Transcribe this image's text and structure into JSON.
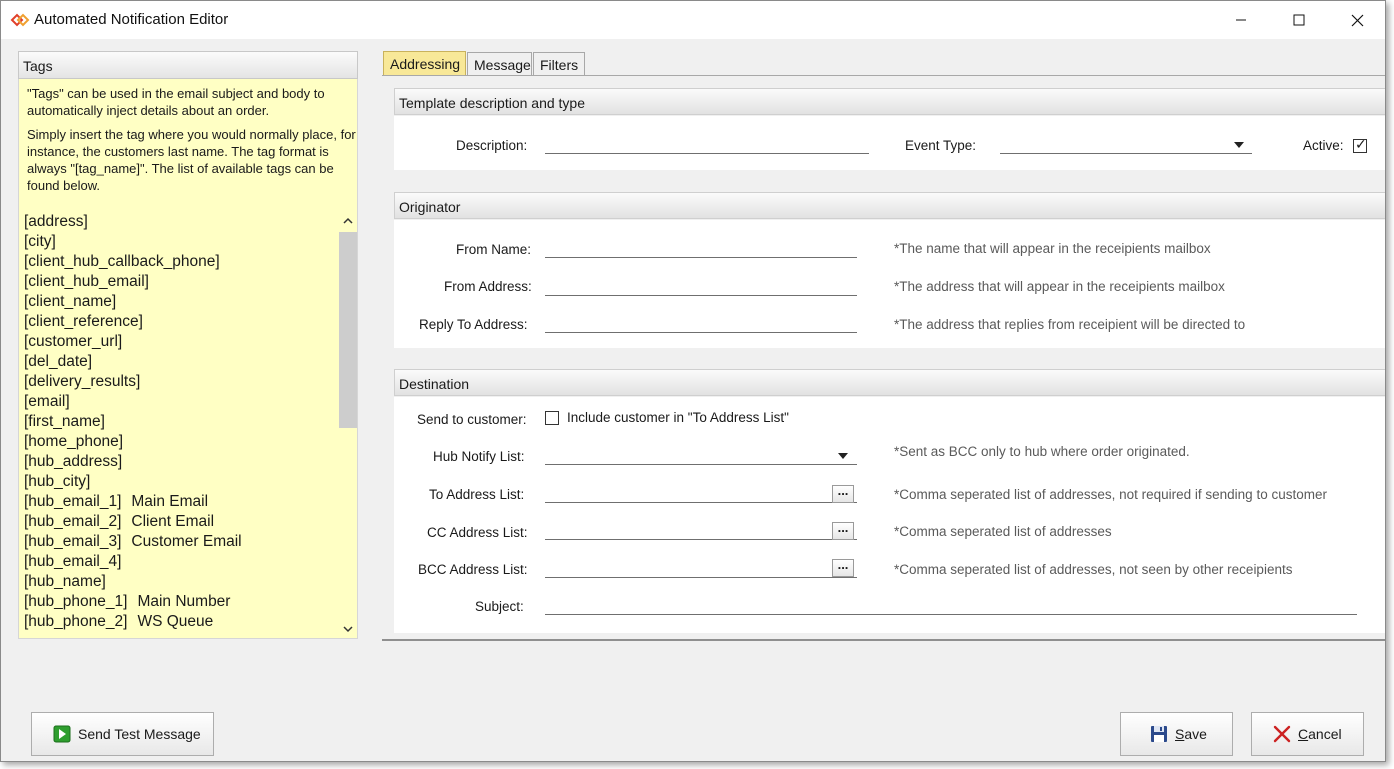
{
  "window": {
    "title": "Automated Notification Editor"
  },
  "tags_panel": {
    "header": "Tags",
    "intro": "\"Tags\" can be used in the email subject and body to automatically inject details about an order.",
    "instructions": "Simply insert the tag where you would normally place, for instance, the customers last name.  The tag format is always \"[tag_name]\".  The list of available tags can be found below.",
    "tags": [
      {
        "name": "[address]",
        "desc": ""
      },
      {
        "name": "[city]",
        "desc": ""
      },
      {
        "name": "[client_hub_callback_phone]",
        "desc": ""
      },
      {
        "name": "[client_hub_email]",
        "desc": ""
      },
      {
        "name": "[client_name]",
        "desc": ""
      },
      {
        "name": "[client_reference]",
        "desc": ""
      },
      {
        "name": "[customer_url]",
        "desc": ""
      },
      {
        "name": "[del_date]",
        "desc": ""
      },
      {
        "name": "[delivery_results]",
        "desc": ""
      },
      {
        "name": "[email]",
        "desc": ""
      },
      {
        "name": "[first_name]",
        "desc": ""
      },
      {
        "name": "[home_phone]",
        "desc": ""
      },
      {
        "name": "[hub_address]",
        "desc": ""
      },
      {
        "name": "[hub_city]",
        "desc": ""
      },
      {
        "name": "[hub_email_1]",
        "desc": "Main Email"
      },
      {
        "name": "[hub_email_2]",
        "desc": "Client Email"
      },
      {
        "name": "[hub_email_3]",
        "desc": "Customer Email"
      },
      {
        "name": "[hub_email_4]",
        "desc": ""
      },
      {
        "name": "[hub_name]",
        "desc": ""
      },
      {
        "name": "[hub_phone_1]",
        "desc": "Main Number"
      },
      {
        "name": "[hub_phone_2]",
        "desc": "WS Queue"
      }
    ]
  },
  "tabs": [
    "Addressing",
    "Message",
    "Filters"
  ],
  "template_section": {
    "header": "Template description and type",
    "description_label": "Description:",
    "description_value": "",
    "event_type_label": "Event Type:",
    "event_type_value": "",
    "active_label": "Active:",
    "active_checked": true
  },
  "originator": {
    "header": "Originator",
    "from_name_label": "From Name:",
    "from_name_value": "",
    "from_name_hint": "*The name that will appear in the receipients mailbox",
    "from_address_label": "From Address:",
    "from_address_value": "",
    "from_address_hint": "*The address that will appear in the receipients mailbox",
    "reply_to_label": "Reply To Address:",
    "reply_to_value": "",
    "reply_to_hint": "*The address that replies from receipient will be directed to"
  },
  "destination": {
    "header": "Destination",
    "send_to_customer_label": "Send to customer:",
    "include_customer_label": "Include customer in \"To Address List\"",
    "include_customer_checked": false,
    "hub_notify_label": "Hub Notify List:",
    "hub_notify_value": "",
    "hub_notify_hint": "*Sent as BCC only to hub where order originated.",
    "to_label": "To Address List:",
    "to_value": "",
    "to_hint": "*Comma seperated list of addresses, not required if sending to customer",
    "cc_label": "CC Address List:",
    "cc_value": "",
    "cc_hint": "*Comma seperated list of addresses",
    "bcc_label": "BCC Address List:",
    "bcc_value": "",
    "bcc_hint": "*Comma seperated list of addresses, not seen by other receipients",
    "subject_label": "Subject:",
    "subject_value": "",
    "ellipsis": "..."
  },
  "footer": {
    "send_test": "Send Test Message",
    "save_first": "S",
    "save_rest": "ave",
    "cancel_first": "C",
    "cancel_rest": "ancel"
  },
  "colors": {
    "tags_background": "#ffffc4",
    "active_tab": "#f8e898",
    "close_icon": "#cc2222",
    "play_icon": "#2e9e2e"
  }
}
